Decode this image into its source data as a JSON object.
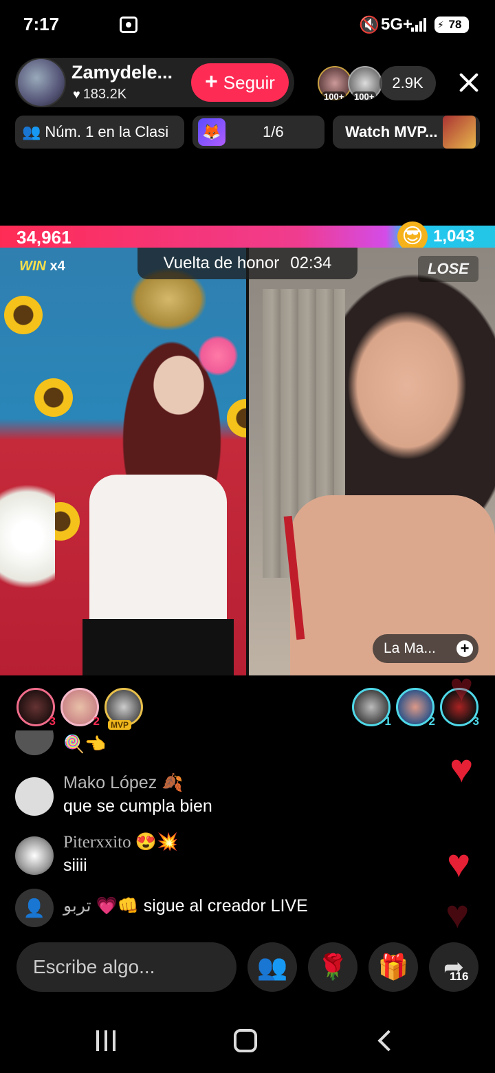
{
  "status_bar": {
    "time": "7:17",
    "network": "5G+",
    "battery": "78"
  },
  "host": {
    "name": "Zamydele...",
    "likes": "183.2K",
    "follow_label": "Seguir"
  },
  "viewers": {
    "badges": [
      "100+",
      "100+"
    ],
    "count": "2.9K"
  },
  "info_pills": {
    "rank": "Núm. 1 en la Clasi",
    "game_progress": "1/6",
    "mvp": "Watch MVP..."
  },
  "battle": {
    "left_score": "34,961",
    "right_score": "1,043",
    "round_label": "Vuelta de honor",
    "timer": "02:34",
    "win_label": "WIN",
    "win_count": "x4",
    "lose_label": "LOSE",
    "opponent_name": "La Ma..."
  },
  "supporters": {
    "left": [
      {
        "rank": "3"
      },
      {
        "rank": "2"
      },
      {
        "rank": "MVP"
      }
    ],
    "right": [
      {
        "rank": "1"
      },
      {
        "rank": "2"
      },
      {
        "rank": "3"
      }
    ]
  },
  "chat": [
    {
      "user": "",
      "text": "🍭👈"
    },
    {
      "user": "Mako López 🍂",
      "text": "que se cumpla bien"
    },
    {
      "user": "Piterxxito 😍💥",
      "text": "siiii"
    }
  ],
  "system_message": {
    "user": "تربو 💗👊",
    "text": "sigue al creador LIVE"
  },
  "bottom_bar": {
    "comment_placeholder": "Escribe algo...",
    "share_count": "116"
  },
  "colors": {
    "accent": "#fe2c55",
    "opponent": "#24c6e6",
    "win": "#f7e04a"
  }
}
